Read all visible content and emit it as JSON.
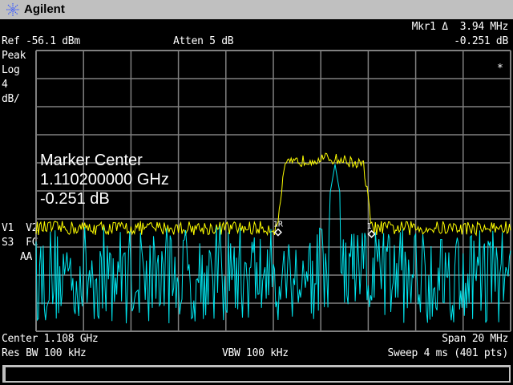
{
  "header": {
    "brand": "Agilent"
  },
  "status": {
    "ref_level": "Ref -56.1 dBm",
    "atten": "Atten 5 dB",
    "marker_readout": "Mkr1 Δ  3.94 MHz",
    "marker_value": "-0.251 dB",
    "detector": "Peak",
    "scale_type": "Log",
    "scale_value": "4",
    "scale_unit": "dB/",
    "trace_flags_1": "V1  V2",
    "trace_flags_2": "S3  FC",
    "trace_flags_3": "AA",
    "asterisk": "*"
  },
  "marker_panel": {
    "title": "Marker Center",
    "frequency": "1.110200000 GHz",
    "value": "-0.251 dB",
    "marker_ref_label": "1R",
    "marker_label": "1"
  },
  "footer": {
    "center": "Center 1.108 GHz",
    "span": "Span 20 MHz",
    "rbw": "Res BW 100 kHz",
    "vbw": "VBW 100 kHz",
    "sweep": "Sweep 4 ms (401 pts)"
  },
  "colors": {
    "trace1": "#ffff00",
    "trace2": "#00e5ee",
    "grid": "#808080",
    "titlebar": "#c0c0c0"
  },
  "chart_data": {
    "type": "line",
    "ref_dbm": -56.1,
    "db_per_div": 4,
    "y_divisions": 10,
    "center_mhz": 1108,
    "span_mhz": 20,
    "points": 401,
    "series": [
      {
        "name": "trace1",
        "color": "#ffff00",
        "noise_floor_dbm": -81.4,
        "plateau_dbm": -71.5,
        "band_start_mhz": 1108.2,
        "band_stop_mhz": 1112.1,
        "noise_pp_db": 2
      },
      {
        "name": "trace2",
        "color": "#00e5ee",
        "noise_floor_dbm": -88,
        "peak_dbm": -72.3,
        "peak_mhz": 1110.6,
        "noise_pp_db": 14
      }
    ],
    "markers": [
      {
        "label": "1R",
        "freq_mhz": 1108.2,
        "dbm": -82.0
      },
      {
        "label": "1",
        "freq_mhz": 1112.14,
        "dbm": -82.25
      }
    ]
  }
}
